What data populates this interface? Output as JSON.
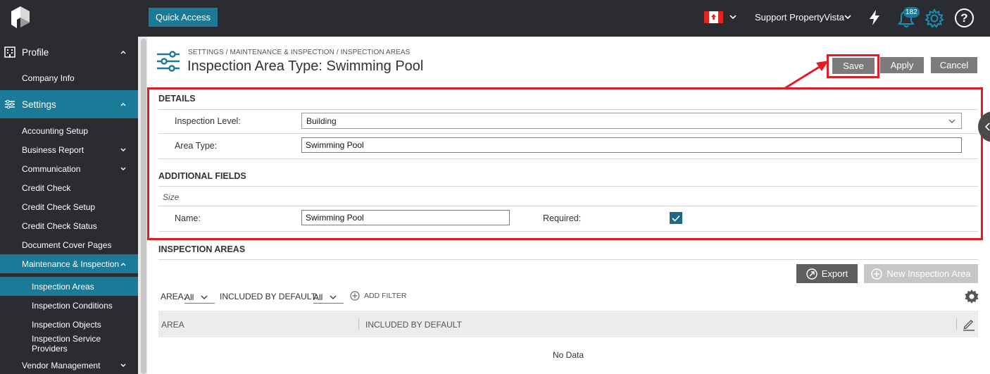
{
  "topbar": {
    "quick_access": "Quick Access",
    "user_name": "Support PropertyVista",
    "notification_count": "182",
    "help_symbol": "?"
  },
  "sidebar": {
    "profile": "Profile",
    "company_info": "Company Info",
    "settings": "Settings",
    "items": [
      "Accounting Setup",
      "Business Report",
      "Communication",
      "Credit Check",
      "Credit Check Setup",
      "Credit Check Status",
      "Document Cover Pages",
      "Maintenance & Inspection"
    ],
    "sub_items": [
      "Inspection Areas",
      "Inspection Conditions",
      "Inspection Objects",
      "Inspection Service Providers"
    ],
    "vendor_management": "Vendor Management"
  },
  "header": {
    "breadcrumb": "SETTINGS / MAINTENANCE & INSPECTION / INSPECTION AREAS",
    "title": "Inspection Area Type: Swimming Pool",
    "save": "Save",
    "apply": "Apply",
    "cancel": "Cancel"
  },
  "details": {
    "section": "DETAILS",
    "inspection_level_label": "Inspection Level:",
    "inspection_level_value": "Building",
    "area_type_label": "Area Type:",
    "area_type_value": "Swimming Pool"
  },
  "additional": {
    "section": "ADDITIONAL FIELDS",
    "group": "Size",
    "name_label": "Name:",
    "name_value": "Swimming Pool",
    "required_label": "Required:",
    "required_checked": true
  },
  "areas": {
    "section": "INSPECTION AREAS",
    "export": "Export",
    "new_area": "New Inspection Area",
    "filter_area_label": "AREA:",
    "filter_area_value": "All",
    "filter_default_label": "INCLUDED BY DEFAULT:",
    "filter_default_value": "All",
    "add_filter": "ADD FILTER",
    "col_area": "AREA",
    "col_default": "INCLUDED BY DEFAULT",
    "empty": "No Data"
  },
  "colors": {
    "accent": "#1a7a97",
    "highlight": "#e21d24",
    "topbar": "#2a2c31"
  }
}
